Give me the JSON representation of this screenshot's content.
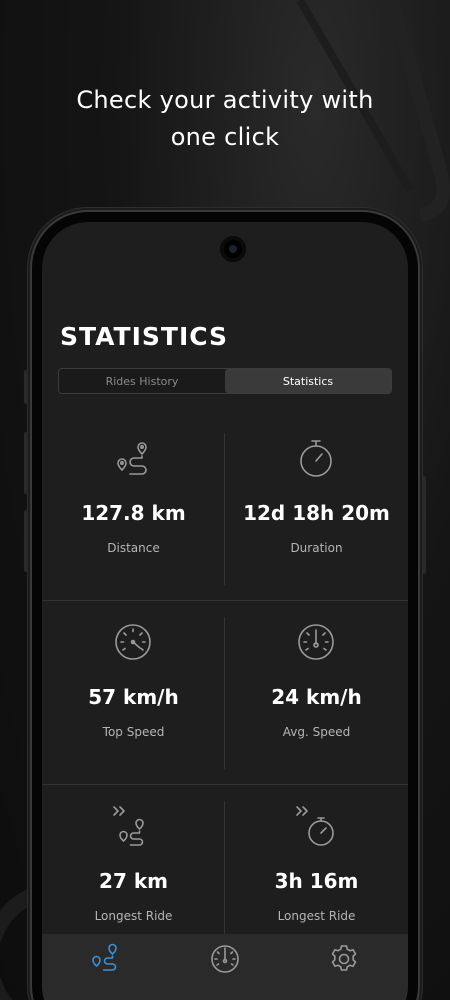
{
  "headline": {
    "line1": "Check your activity with",
    "line2": "one click"
  },
  "screen": {
    "title": "STATISTICS",
    "tabs": [
      {
        "label": "Rides History",
        "active": false
      },
      {
        "label": "Statistics",
        "active": true
      }
    ],
    "stats": [
      {
        "value": "127.8 km",
        "label": "Distance",
        "icon": "route-pin-icon"
      },
      {
        "value": "12d 18h 20m",
        "label": "Duration",
        "icon": "stopwatch-icon"
      },
      {
        "value": "57 km/h",
        "label": "Top Speed",
        "icon": "speedometer-icon"
      },
      {
        "value": "24 km/h",
        "label": "Avg. Speed",
        "icon": "speedometer-center-icon"
      },
      {
        "value": "27 km",
        "label": "Longest Ride",
        "icon": "fast-route-icon"
      },
      {
        "value": "3h 16m",
        "label": "Longest Ride",
        "icon": "fast-stopwatch-icon"
      }
    ],
    "nav": [
      {
        "icon": "route-nav-icon",
        "active": true
      },
      {
        "icon": "dashboard-nav-icon",
        "active": false
      },
      {
        "icon": "settings-gear-icon",
        "active": false
      }
    ]
  },
  "colors": {
    "accent": "#3d8fd6",
    "background": "#1e1e1e",
    "text": "#ffffff",
    "muted": "#b5b5b5"
  }
}
